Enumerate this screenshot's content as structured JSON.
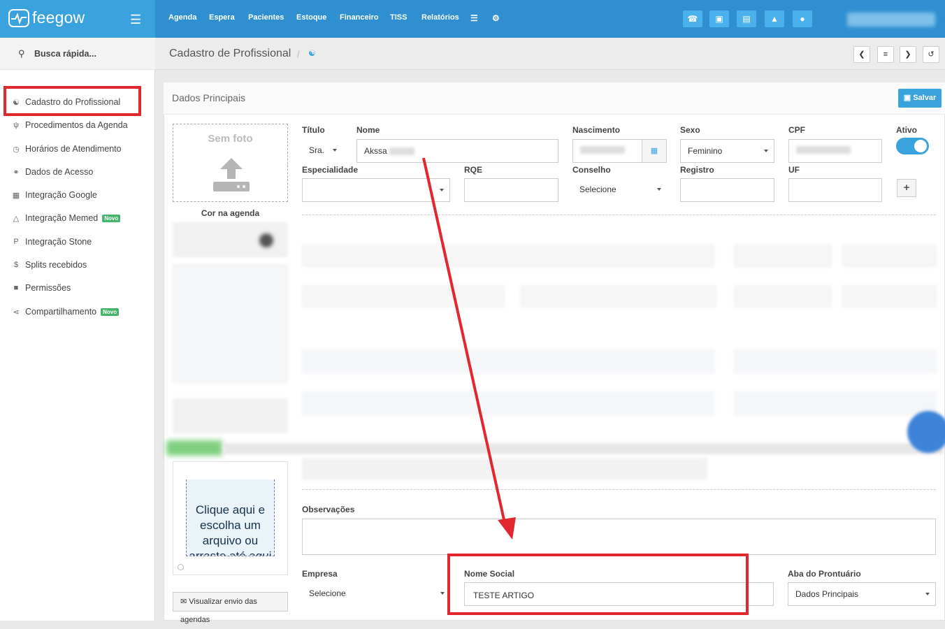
{
  "topbar": {
    "logo_text": "feegow",
    "nav": [
      "Agenda",
      "Espera",
      "Pacientes",
      "Estoque",
      "Financeiro",
      "TISS",
      "Relatórios"
    ],
    "icons": [
      "phone-icon",
      "inbox-icon",
      "card-icon",
      "bell-icon",
      "chat-icon"
    ]
  },
  "sidebar": {
    "search_label": "Busca rápida...",
    "items": [
      {
        "label": "Cadastro do Profissional",
        "icon": "sitemap-icon"
      },
      {
        "label": "Procedimentos da Agenda",
        "icon": "stethoscope-icon"
      },
      {
        "label": "Horários de Atendimento",
        "icon": "clock-icon"
      },
      {
        "label": "Dados de Acesso",
        "icon": "key-icon"
      },
      {
        "label": "Integração Google",
        "icon": "calendar-icon"
      },
      {
        "label": "Integração Memed",
        "icon": "flask-icon",
        "badge": "Novo"
      },
      {
        "label": "Integração Stone",
        "icon": "stone-icon"
      },
      {
        "label": "Splits recebidos",
        "icon": "dollar-icon"
      },
      {
        "label": "Permissões",
        "icon": "lock-icon"
      },
      {
        "label": "Compartilhamento",
        "icon": "share-icon",
        "badge": "Novo"
      }
    ]
  },
  "header": {
    "title": "Cadastro de Profissional",
    "separator": "/"
  },
  "panel": {
    "title": "Dados Principais",
    "save_label": "Salvar",
    "photo_label": "Sem foto",
    "color_label": "Cor na agenda",
    "upload_text_1": "Clique aqui e",
    "upload_text_2": "escolha um",
    "upload_text_3": "arquivo",
    "upload_text_4": " ou",
    "upload_text_5": "arraste até aqui",
    "send_agenda_label": "Visualizar envio das agendas"
  },
  "form": {
    "titulo": {
      "label": "Título",
      "value": "Sra."
    },
    "nome": {
      "label": "Nome",
      "value": "Akssa"
    },
    "nascimento": {
      "label": "Nascimento"
    },
    "sexo": {
      "label": "Sexo",
      "value": "Feminino"
    },
    "cpf": {
      "label": "CPF"
    },
    "ativo": {
      "label": "Ativo",
      "on": true
    },
    "especialidade": {
      "label": "Especialidade",
      "value": ""
    },
    "rqe": {
      "label": "RQE"
    },
    "conselho": {
      "label": "Conselho",
      "value": "Selecione"
    },
    "registro": {
      "label": "Registro"
    },
    "uf": {
      "label": "UF"
    },
    "add_symbol": "+",
    "observacoes": {
      "label": "Observações"
    },
    "empresa": {
      "label": "Empresa",
      "value": "Selecione"
    },
    "nome_social": {
      "label": "Nome Social",
      "value": "TESTE ARTIGO"
    },
    "aba_prontuario": {
      "label": "Aba do Prontuário",
      "value": "Dados Principais"
    }
  },
  "colors": {
    "topbar": "#2f8fd0",
    "logo_bg": "#3aa2dc",
    "accent": "#3aa2dc",
    "annotation": "#e0282e",
    "badge": "#46b46b"
  }
}
